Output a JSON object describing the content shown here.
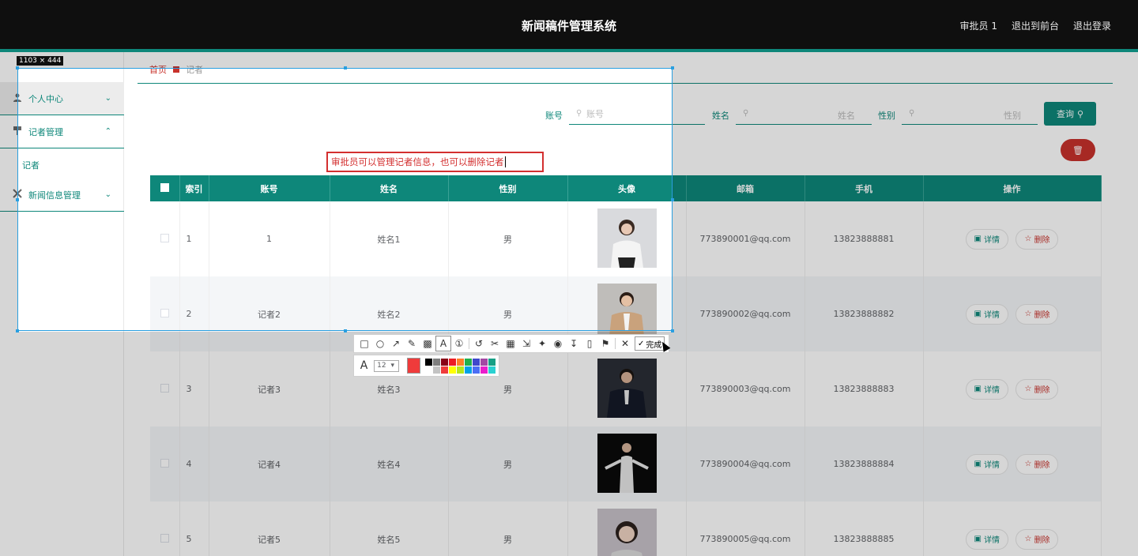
{
  "header": {
    "title": "新闻稿件管理系统",
    "links": [
      "审批员 1",
      "退出到前台",
      "退出登录"
    ]
  },
  "sidebar": {
    "items": [
      {
        "label": "个人中心",
        "icon": "user-icon"
      },
      {
        "label": "记者管理",
        "icon": "reporter-icon"
      },
      {
        "label": "新闻信息管理",
        "icon": "news-icon"
      }
    ],
    "sub_item": "记者"
  },
  "breadcrumb": {
    "home": "首页",
    "current": "记者"
  },
  "filters": {
    "account_label": "账号",
    "account_placeholder": "账号",
    "name_label": "姓名",
    "name_placeholder": "姓名",
    "gender_label": "性别",
    "gender_placeholder": "性别",
    "query_button": "查询",
    "delete_icon": "trash-icon"
  },
  "table": {
    "columns": [
      "索引",
      "账号",
      "姓名",
      "性别",
      "头像",
      "邮箱",
      "手机",
      "操作"
    ],
    "rows": [
      {
        "index": "1",
        "account": "1",
        "name": "姓名1",
        "gender": "男",
        "email": "773890001@qq.com",
        "phone": "13823888881"
      },
      {
        "index": "2",
        "account": "记者2",
        "name": "姓名2",
        "gender": "男",
        "email": "773890002@qq.com",
        "phone": "13823888882"
      },
      {
        "index": "3",
        "account": "记者3",
        "name": "姓名3",
        "gender": "男",
        "email": "773890003@qq.com",
        "phone": "13823888883"
      },
      {
        "index": "4",
        "account": "记者4",
        "name": "姓名4",
        "gender": "男",
        "email": "773890004@qq.com",
        "phone": "13823888884"
      },
      {
        "index": "5",
        "account": "记者5",
        "name": "姓名5",
        "gender": "男",
        "email": "773890005@qq.com",
        "phone": "13823888885"
      }
    ],
    "detail_label": "详情",
    "delete_label": "删除"
  },
  "capture": {
    "size_label": "1103 × 444",
    "annotation_text": "审批员可以管理记者信息，也可以删除记者",
    "done_label": "完成",
    "font_size": "12",
    "current_color": "#ef3b3b",
    "palette": [
      "#000000",
      "#7f7f7f",
      "#880015",
      "#ed1c24",
      "#ff7f27",
      "#22b14c",
      "#3f48cc",
      "#a349a4",
      "#16a085",
      "#ffffff",
      "#c3c3c3",
      "#ef3b3b",
      "#ffff00",
      "#b5e61d",
      "#00a2e8",
      "#4c6ef5",
      "#e91ecc",
      "#2ad1d1"
    ]
  }
}
